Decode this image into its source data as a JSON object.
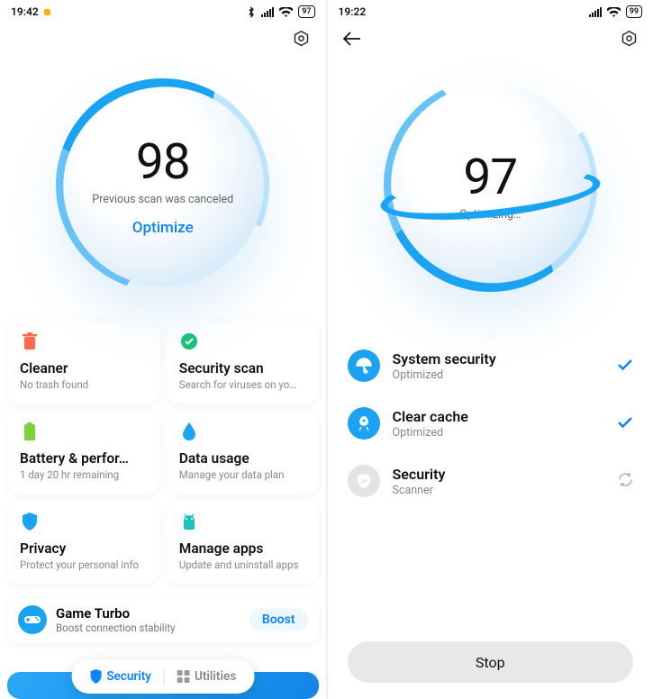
{
  "left": {
    "status": {
      "time": "19:42",
      "battery": "97"
    },
    "orb": {
      "score": "98",
      "subtitle": "Previous scan was canceled",
      "action": "Optimize"
    },
    "tiles": [
      {
        "icon": "trash",
        "color": "#ff6b4a",
        "title": "Cleaner",
        "sub": "No trash found"
      },
      {
        "icon": "check",
        "color": "#17c37b",
        "title": "Security scan",
        "sub": "Search for viruses on yo…"
      },
      {
        "icon": "battery",
        "color": "#7bd23a",
        "title": "Battery & perfor…",
        "sub": "1 day 20 hr  remaining"
      },
      {
        "icon": "drop",
        "color": "#1aa3f2",
        "title": "Data usage",
        "sub": "Manage your data plan"
      },
      {
        "icon": "shield",
        "color": "#1aa3f2",
        "title": "Privacy",
        "sub": "Protect your personal info"
      },
      {
        "icon": "android",
        "color": "#1cc2c0",
        "title": "Manage apps",
        "sub": "Update and uninstall apps"
      }
    ],
    "turbo": {
      "title": "Game Turbo",
      "sub": "Boost connection stability",
      "action": "Boost"
    },
    "nav": {
      "security": "Security",
      "utilities": "Utilities"
    }
  },
  "right": {
    "status": {
      "time": "19:22",
      "battery": "99"
    },
    "orb": {
      "score": "97",
      "subtitle": "Optimizing…"
    },
    "items": [
      {
        "icon": "umbrella",
        "title": "System security",
        "sub": "Optimized",
        "done": true
      },
      {
        "icon": "rocket",
        "title": "Clear cache",
        "sub": "Optimized",
        "done": true
      },
      {
        "icon": "shield",
        "title": "Security",
        "sub": "Scanner",
        "done": false
      }
    ],
    "stop": "Stop"
  }
}
